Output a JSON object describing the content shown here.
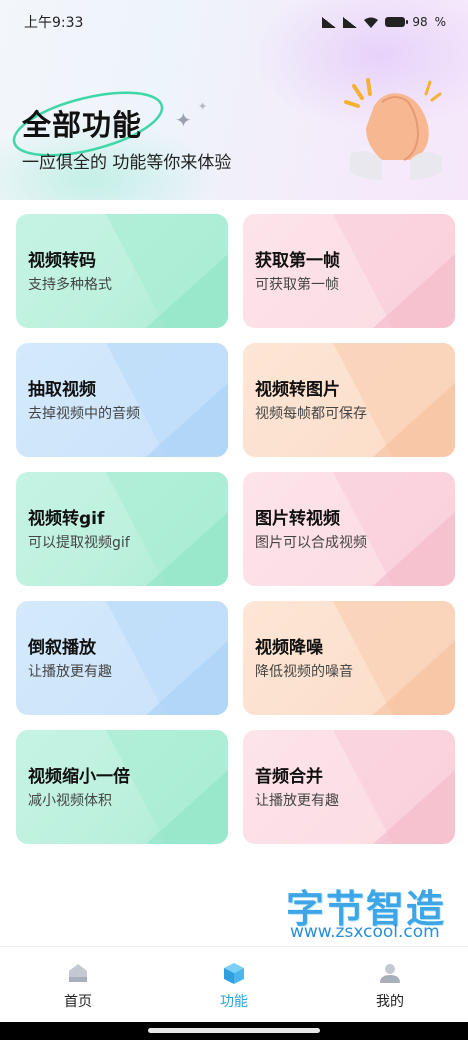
{
  "status_bar": {
    "time": "上午9:33",
    "battery": "98"
  },
  "hero": {
    "title": "全部功能",
    "subtitle": "一应俱全的 功能等你来体验"
  },
  "cards": [
    {
      "title": "视频转码",
      "subtitle": "支持多种格式",
      "color": "green"
    },
    {
      "title": "获取第一帧",
      "subtitle": "可获取第一帧",
      "color": "pink"
    },
    {
      "title": "抽取视频",
      "subtitle": "去掉视频中的音频",
      "color": "blue"
    },
    {
      "title": "视频转图片",
      "subtitle": "视频每帧都可保存",
      "color": "orange"
    },
    {
      "title": "视频转gif",
      "subtitle": "可以提取视频gif",
      "color": "green"
    },
    {
      "title": "图片转视频",
      "subtitle": "图片可以合成视频",
      "color": "pink"
    },
    {
      "title": "倒叙播放",
      "subtitle": "让播放更有趣",
      "color": "blue"
    },
    {
      "title": "视频降噪",
      "subtitle": "降低视频的噪音",
      "color": "orange"
    },
    {
      "title": "视频缩小一倍",
      "subtitle": "减小视频体积",
      "color": "green"
    },
    {
      "title": "音频合并",
      "subtitle": "让播放更有趣",
      "color": "pink"
    }
  ],
  "watermark": {
    "brand": "字节智造",
    "url": "www.zsxcool.com"
  },
  "bottom_nav": [
    {
      "label": "首页",
      "icon": "home-icon",
      "active": false
    },
    {
      "label": "功能",
      "icon": "cube-icon",
      "active": true
    },
    {
      "label": "我的",
      "icon": "user-icon",
      "active": false
    }
  ],
  "colors": {
    "accent": "#2ea0e0",
    "green": "#c5f3e4",
    "pink": "#fbdbe3",
    "blue": "#d4e9fb",
    "orange": "#fde6d6"
  }
}
